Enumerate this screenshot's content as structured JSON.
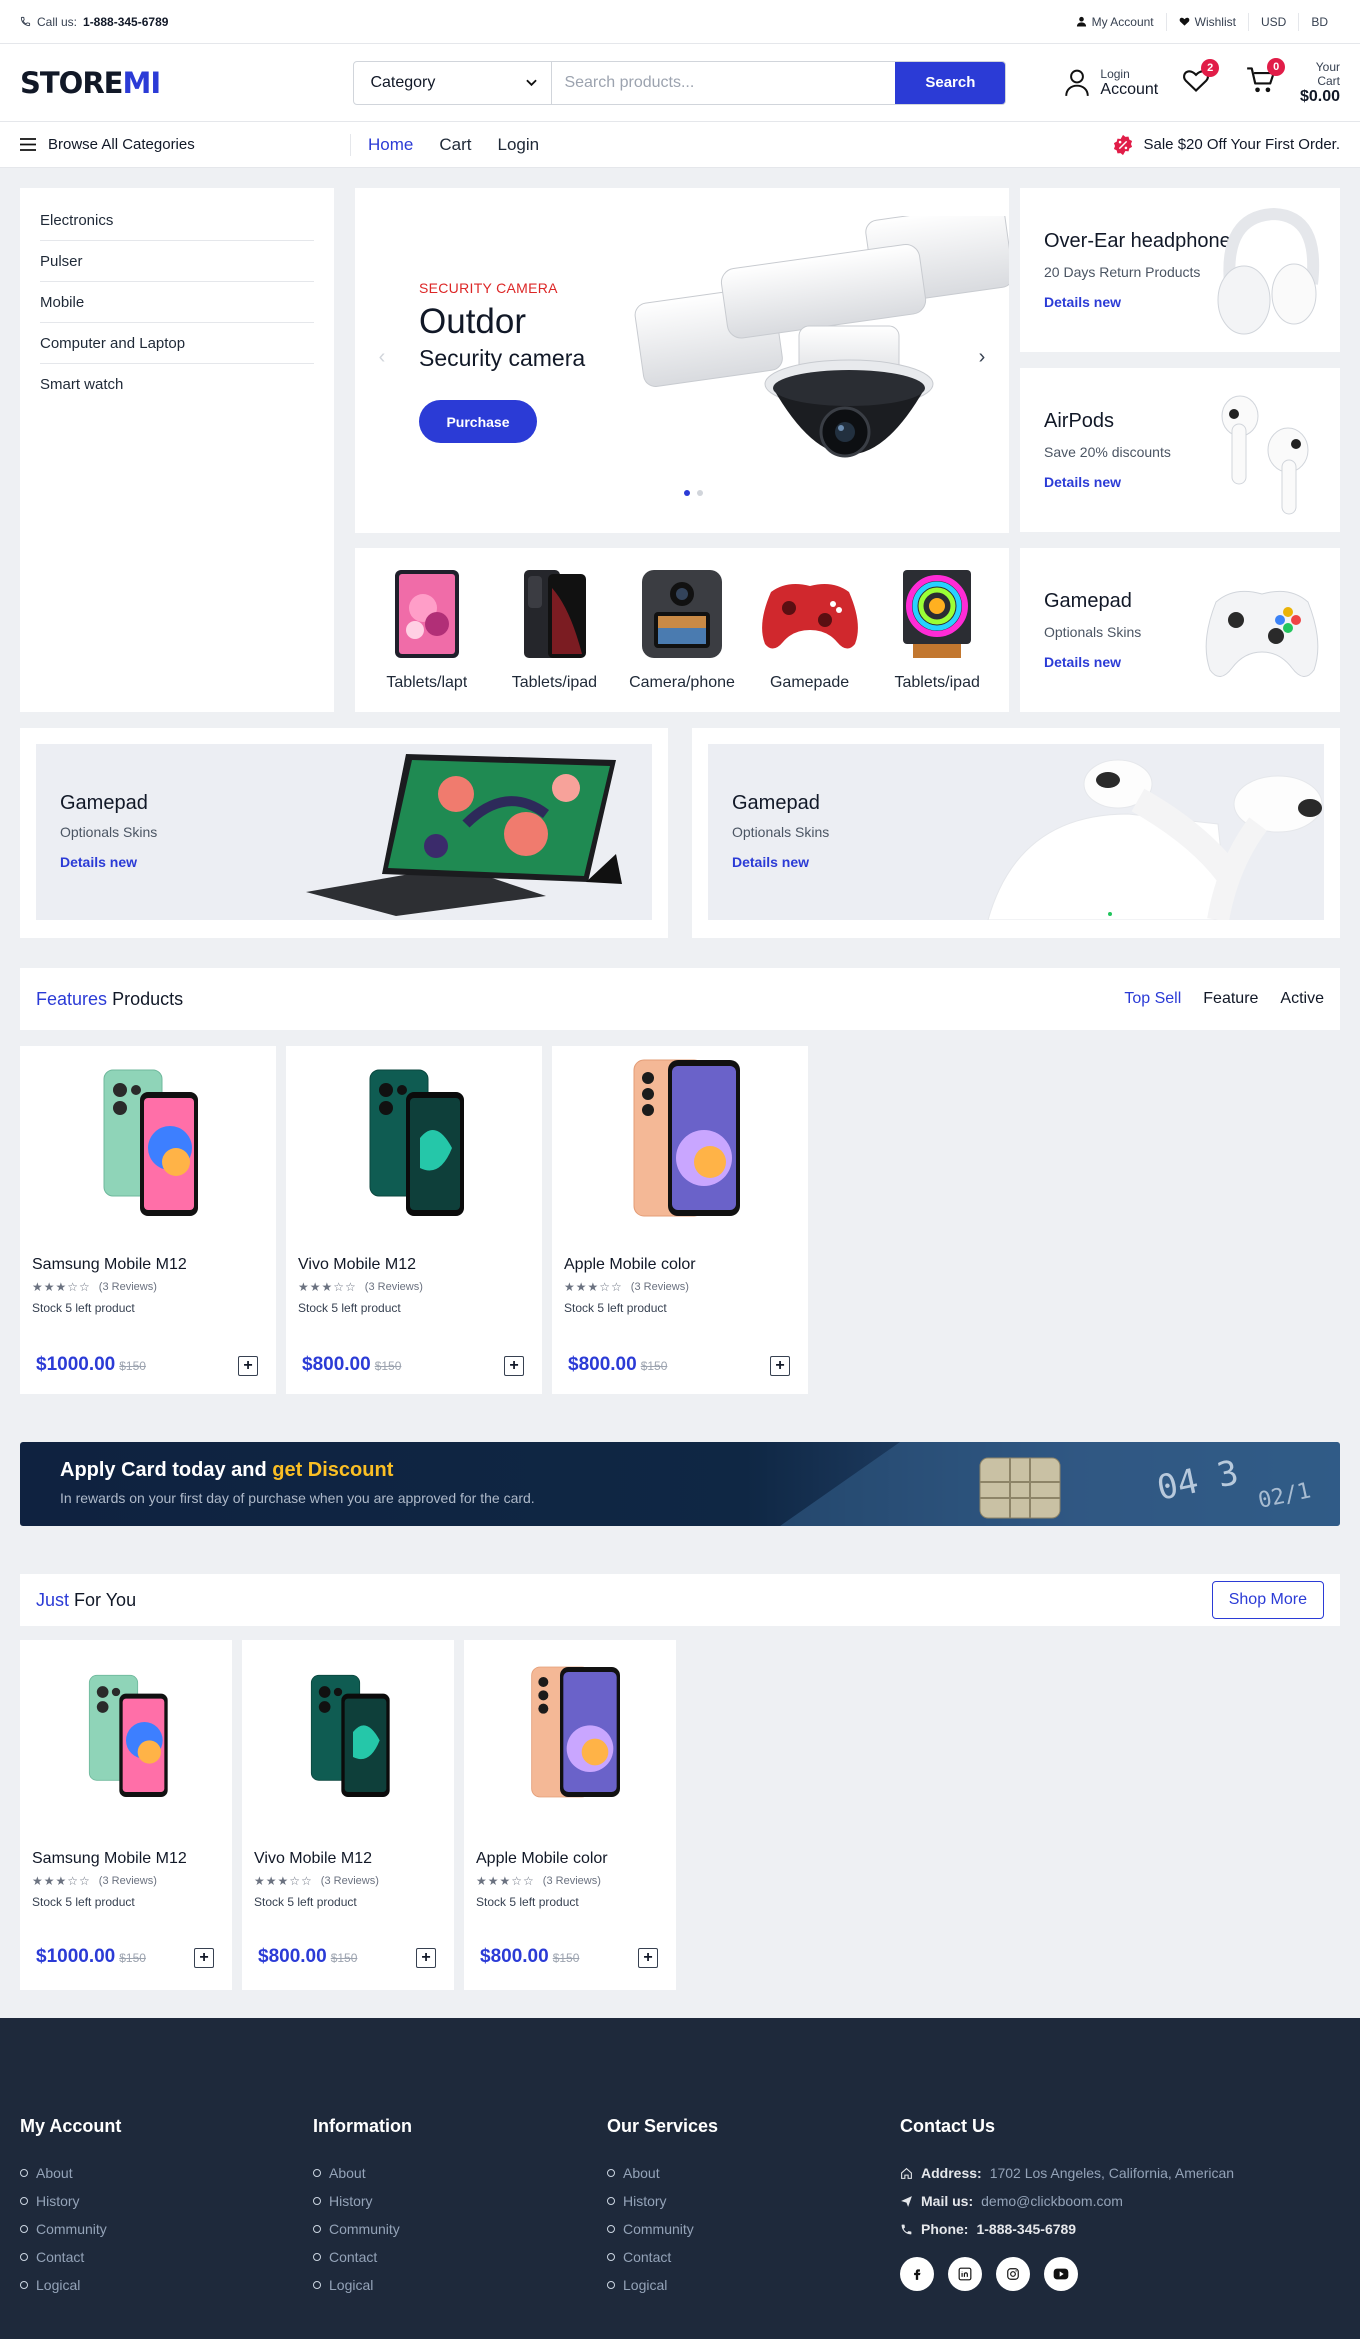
{
  "topbar": {
    "call_label": "Call us:",
    "phone": "1-888-345-6789",
    "my_account": "My Account",
    "wishlist": "Wishlist",
    "currency": "USD",
    "language": "BD"
  },
  "header": {
    "logo_main": "STORE",
    "logo_accent": "MI",
    "category_select": "Category",
    "search_placeholder": "Search products...",
    "search_button": "Search",
    "login_small": "Login",
    "login_big": "Account",
    "wishlist_count": "2",
    "cart_count": "0",
    "cart_label": "Your Cart",
    "cart_total": "$0.00"
  },
  "nav": {
    "browse": "Browse All Categories",
    "links": [
      "Home",
      "Cart",
      "Login"
    ],
    "promo": "Sale $20 Off Your First Order."
  },
  "categories": [
    "Electronics",
    "Pulser",
    "Mobile",
    "Computer and Laptop",
    "Smart watch"
  ],
  "slider": {
    "kicker": "SECURITY CAMERA",
    "title": "Outdor",
    "subtitle": "Security camera",
    "button": "Purchase"
  },
  "category_strip": [
    {
      "label": "Tablets/lapt",
      "icon": "tablet-pink"
    },
    {
      "label": "Tablets/ipad",
      "icon": "phone-dark"
    },
    {
      "label": "Camera/phone",
      "icon": "action-camera"
    },
    {
      "label": "Gamepade",
      "icon": "gamepad-red"
    },
    {
      "label": "Tablets/ipad",
      "icon": "rgb-cooler"
    }
  ],
  "side_cards": [
    {
      "title": "Over-Ear headphone",
      "subtitle": "20 Days Return Products",
      "link": "Details new",
      "icon": "headphone"
    },
    {
      "title": "AirPods",
      "subtitle": "Save 20% discounts",
      "link": "Details new",
      "icon": "airpods"
    },
    {
      "title": "Gamepad",
      "subtitle": "Optionals Skins",
      "link": "Details new",
      "icon": "gamepad-white"
    }
  ],
  "banners": [
    {
      "title": "Gamepad",
      "subtitle": "Optionals Skins",
      "link": "Details new",
      "icon": "tablet-keyboard"
    },
    {
      "title": "Gamepad",
      "subtitle": "Optionals Skins",
      "link": "Details new",
      "icon": "airpods-case"
    }
  ],
  "features": {
    "title_accent": "Features",
    "title_rest": "Products",
    "tabs": [
      "Top Sell",
      "Feature",
      "Active"
    ]
  },
  "products": [
    {
      "name": "Samsung Mobile M12",
      "stars": "★★★☆☆",
      "reviews": "(3 Reviews)",
      "stock": "Stock 5 left product",
      "price": "$1000.00",
      "old_price": "$150",
      "color": "#8fd4b8"
    },
    {
      "name": "Vivo Mobile M12",
      "stars": "★★★☆☆",
      "reviews": "(3 Reviews)",
      "stock": "Stock 5 left product",
      "price": "$800.00",
      "old_price": "$150",
      "color": "#0f5c52"
    },
    {
      "name": "Apple Mobile color",
      "stars": "★★★☆☆",
      "reviews": "(3 Reviews)",
      "stock": "Stock 5 left product",
      "price": "$800.00",
      "old_price": "$150",
      "color": "#f4b896"
    }
  ],
  "apply": {
    "title_main": "Apply Card today and ",
    "title_accent": "get Discount",
    "subtitle": "In rewards on your first day of purchase when you are approved for the card."
  },
  "just_for_you": {
    "title_accent": "Just",
    "title_rest": "For You",
    "button": "Shop More"
  },
  "footer": {
    "columns": [
      {
        "heading": "My Account",
        "links": [
          "About",
          "History",
          "Community",
          "Contact",
          "Logical"
        ]
      },
      {
        "heading": "Information",
        "links": [
          "About",
          "History",
          "Community",
          "Contact",
          "Logical"
        ]
      },
      {
        "heading": "Our Services",
        "links": [
          "About",
          "History",
          "Community",
          "Contact",
          "Logical"
        ]
      }
    ],
    "contact": {
      "heading": "Contact Us",
      "address_label": "Address:",
      "address": "1702 Los Angeles, California, American",
      "mail_label": "Mail us:",
      "mail": "demo@clickboom.com",
      "phone_label": "Phone:",
      "phone": "1-888-345-6789"
    },
    "socials": [
      "facebook-icon",
      "linkedin-icon",
      "instagram-icon",
      "youtube-icon"
    ]
  },
  "colors": {
    "accent": "#2b3bd6",
    "danger": "#e11d48",
    "footer_bg": "#1e293b",
    "promo_gold": "#fbbf24"
  }
}
